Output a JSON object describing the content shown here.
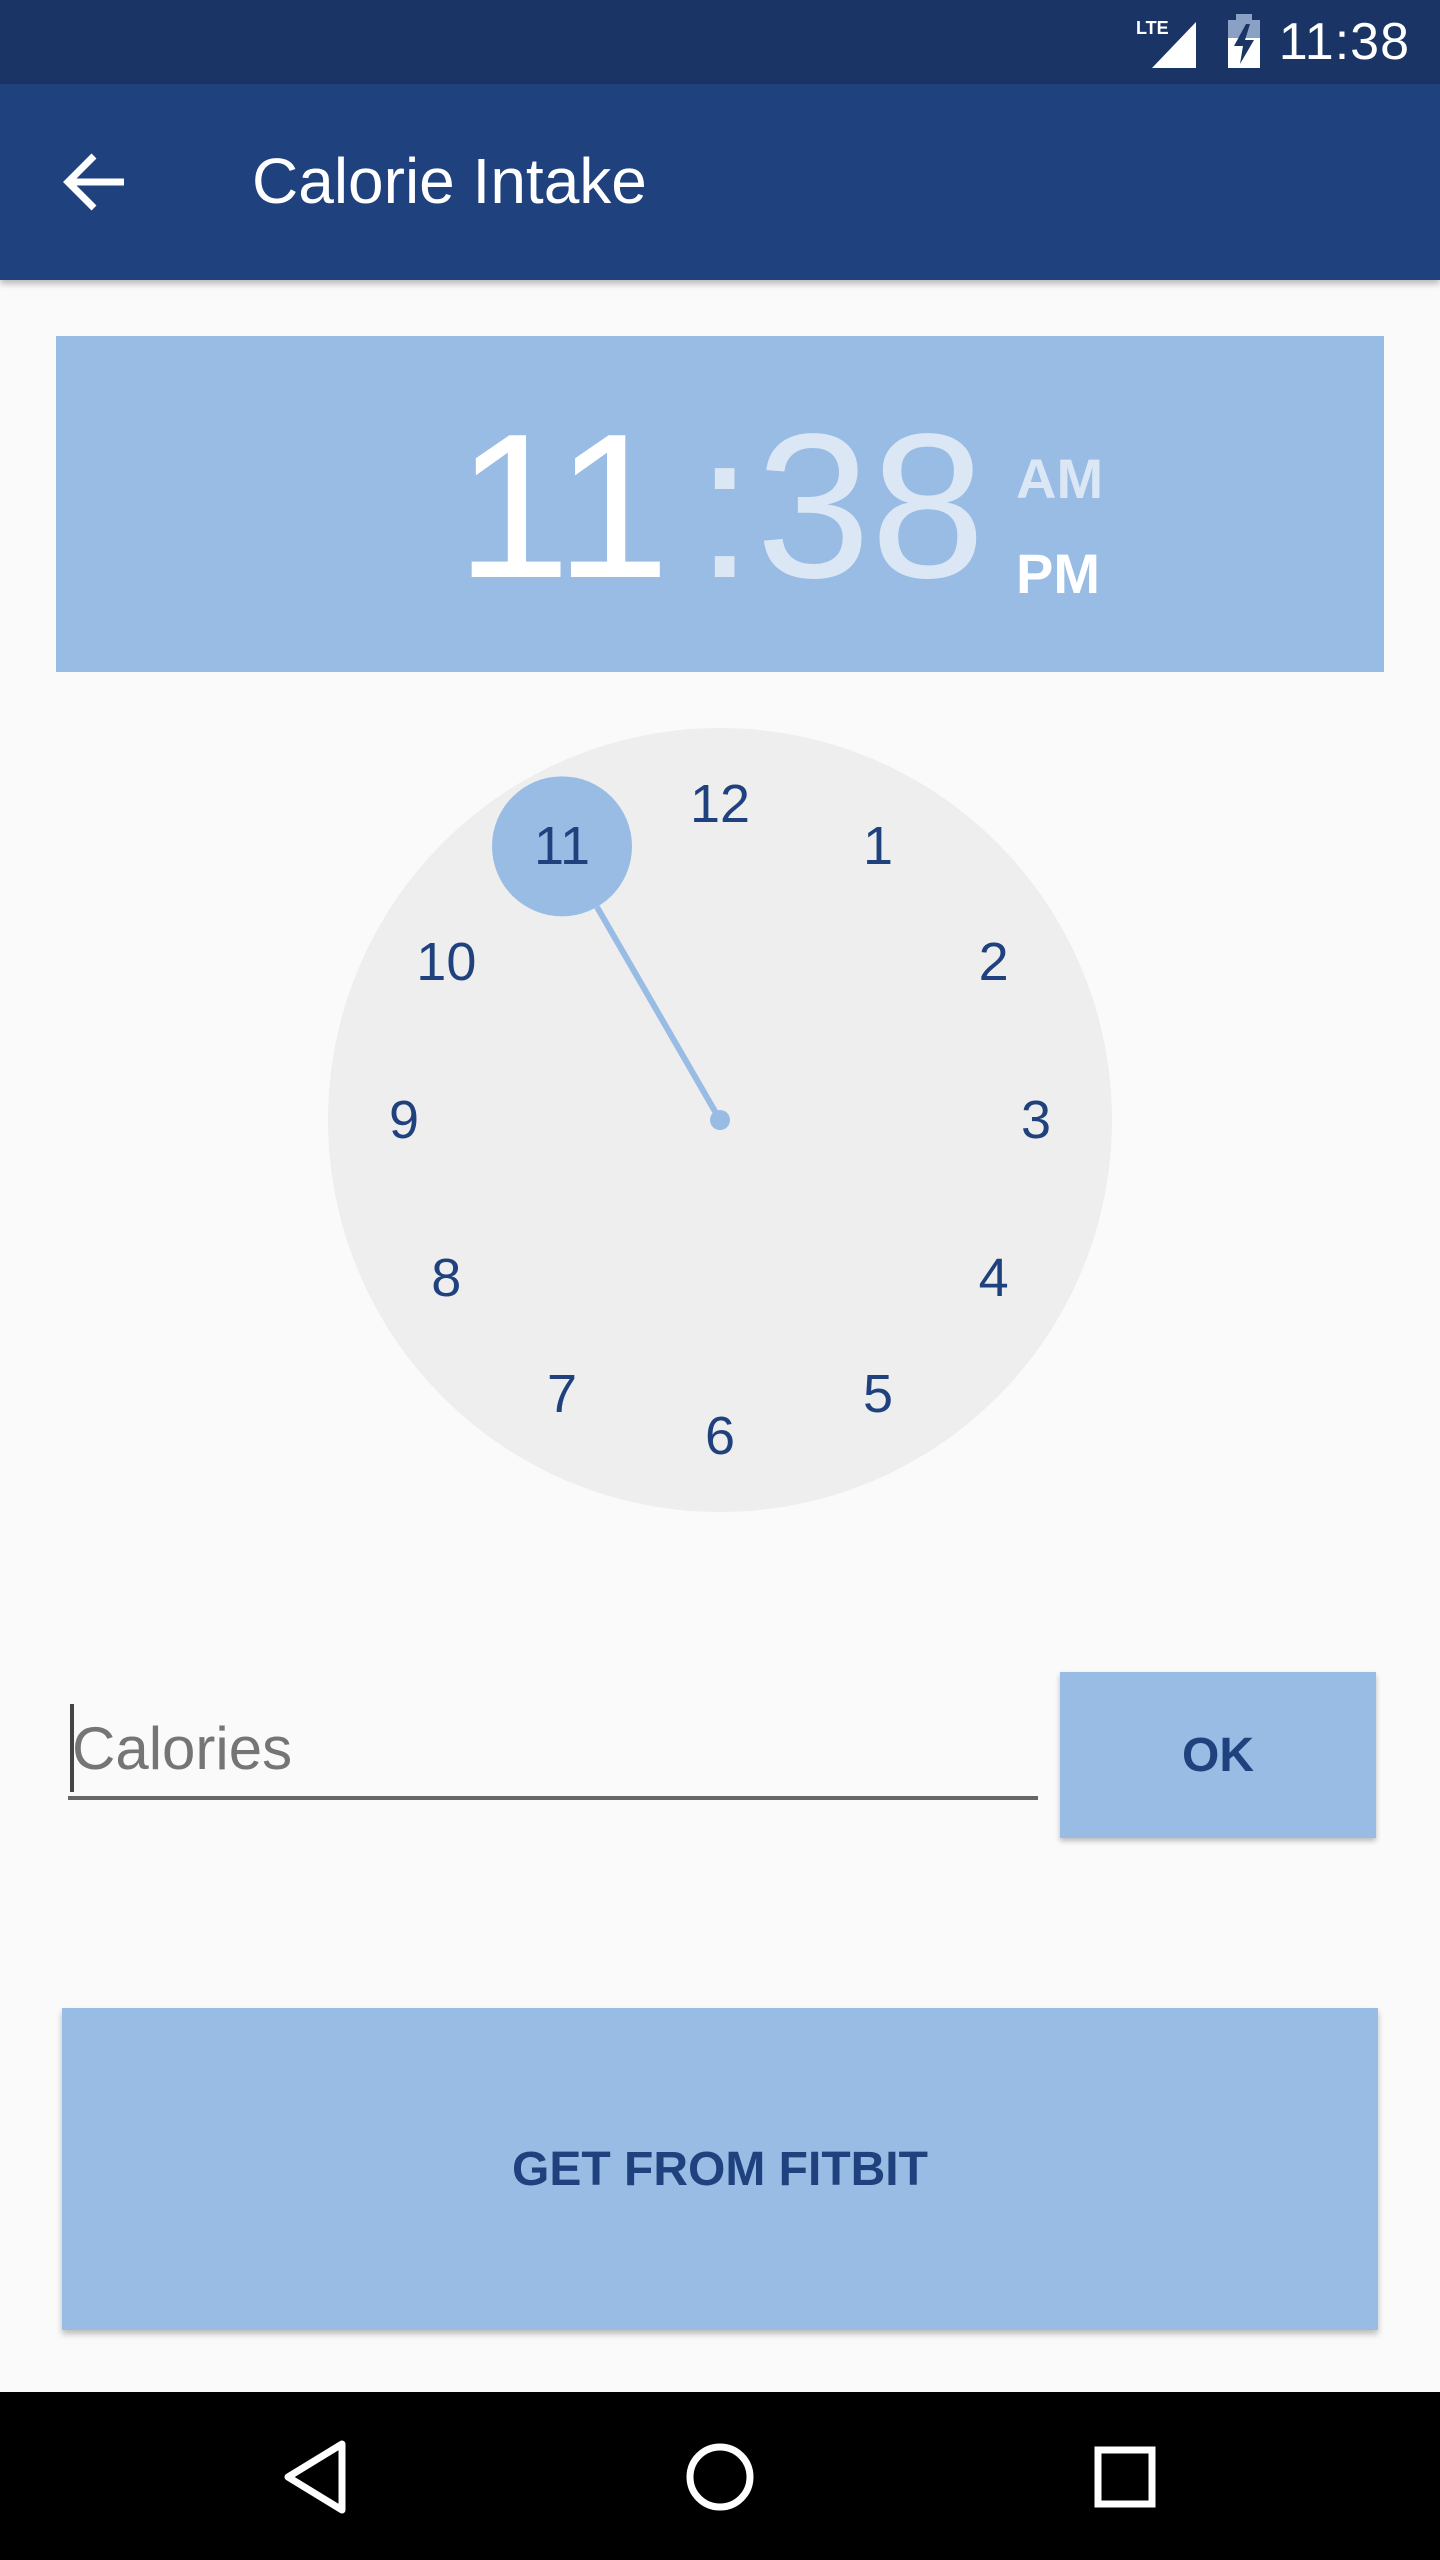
{
  "status_bar": {
    "network": "LTE",
    "time": "11:38",
    "icons": [
      "lte-signal-icon",
      "battery-charging-icon"
    ]
  },
  "app_bar": {
    "title": "Calorie Intake",
    "back_icon": "arrow-back-icon"
  },
  "time_picker": {
    "hour": "11",
    "separator": ":",
    "minute": "38",
    "am_label": "AM",
    "pm_label": "PM",
    "selected_period": "PM",
    "selected_hour": 11,
    "clock_numbers": [
      "12",
      "1",
      "2",
      "3",
      "4",
      "5",
      "6",
      "7",
      "8",
      "9",
      "10",
      "11"
    ]
  },
  "calories_input": {
    "placeholder": "Calories",
    "value": ""
  },
  "ok_button": {
    "label": "OK"
  },
  "fitbit_button": {
    "label": "GET FROM FITBIT"
  },
  "nav_bar": {
    "icons": [
      "back-triangle-icon",
      "home-circle-icon",
      "recents-square-icon"
    ]
  },
  "colors": {
    "status_bar": "#1b3466",
    "app_bar": "#1f417e",
    "accent_light": "#98bce4",
    "clock_face": "#eeeeee",
    "text_dark_blue": "#1f417e",
    "background": "#fafafa"
  }
}
